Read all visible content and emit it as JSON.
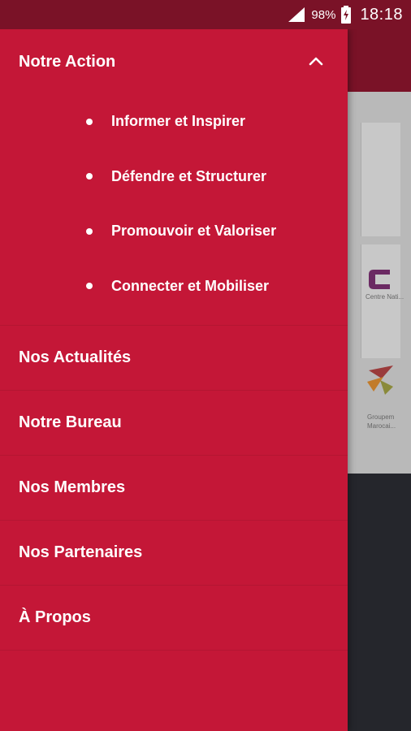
{
  "status_bar": {
    "battery_percent": "98%",
    "time": "18:18",
    "icons": [
      "signal-icon",
      "battery-charging-icon"
    ]
  },
  "drawer": {
    "expanded_section": {
      "title": "Notre Action",
      "icon": "chevron-up-icon",
      "items": [
        {
          "label": "Informer et Inspirer"
        },
        {
          "label": "Défendre et Structurer"
        },
        {
          "label": "Promouvoir et Valoriser"
        },
        {
          "label": "Connecter et Mobiliser"
        }
      ]
    },
    "items": [
      {
        "label": "Nos Actualités"
      },
      {
        "label": "Notre Bureau"
      },
      {
        "label": "Nos Membres"
      },
      {
        "label": "Nos Partenaires"
      },
      {
        "label": "À Propos"
      }
    ]
  },
  "background": {
    "card_texts": [
      "Centre Nati...",
      "Groupem",
      "Marocai..."
    ]
  },
  "colors": {
    "drawer_bg": "#c41737",
    "status_bar_bg": "#7a1227",
    "text": "#ffffff"
  }
}
